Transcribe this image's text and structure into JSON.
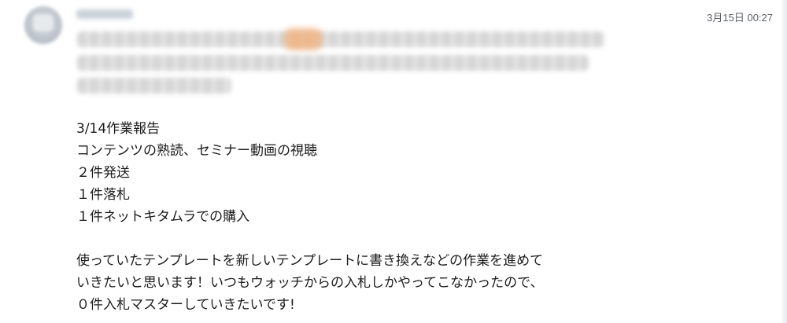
{
  "message": {
    "timestamp": "3月15日 00:27",
    "lines": [
      "3/14作業報告",
      "コンテンツの熟読、セミナー動画の視聴",
      "２件発送",
      "１件落札",
      "１件ネットキタムラでの購入",
      "",
      "使っていたテンプレートを新しいテンプレートに書き換えなどの作業を進めて",
      "いきたいと思います！いつもウォッチからの入札しかやってこなかったので、",
      "０件入札マスターしていきたいです!"
    ]
  }
}
